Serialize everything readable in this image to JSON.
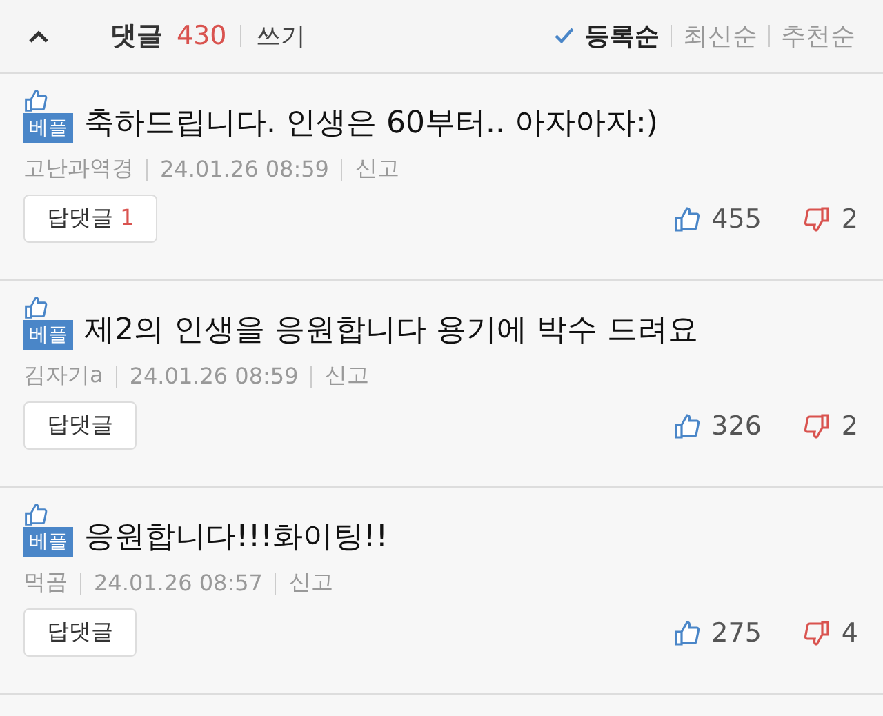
{
  "header": {
    "title": "댓글",
    "count": "430",
    "write": "쓰기"
  },
  "sort_options": [
    {
      "label": "등록순",
      "selected": true
    },
    {
      "label": "최신순",
      "selected": false
    },
    {
      "label": "추천순",
      "selected": false
    }
  ],
  "comments": [
    {
      "badge": "베플",
      "text": "축하드립니다. 인생은 60부터.. 아자아자:)",
      "author": "고난과역경",
      "date": "24.01.26  08:59",
      "report": "신고",
      "reply_label": "답댓글",
      "reply_count": "1",
      "likes": "455",
      "dislikes": "2"
    },
    {
      "badge": "베플",
      "text": "제2의 인생을 응원합니다 용기에 박수 드려요",
      "author": "김자기a",
      "date": "24.01.26  08:59",
      "report": "신고",
      "reply_label": "답댓글",
      "likes": "326",
      "dislikes": "2"
    },
    {
      "badge": "베플",
      "text": "응원합니다!!!화이팅!!",
      "author": "먹곰",
      "date": "24.01.26  08:57",
      "report": "신고",
      "reply_label": "답댓글",
      "likes": "275",
      "dislikes": "4"
    }
  ]
}
